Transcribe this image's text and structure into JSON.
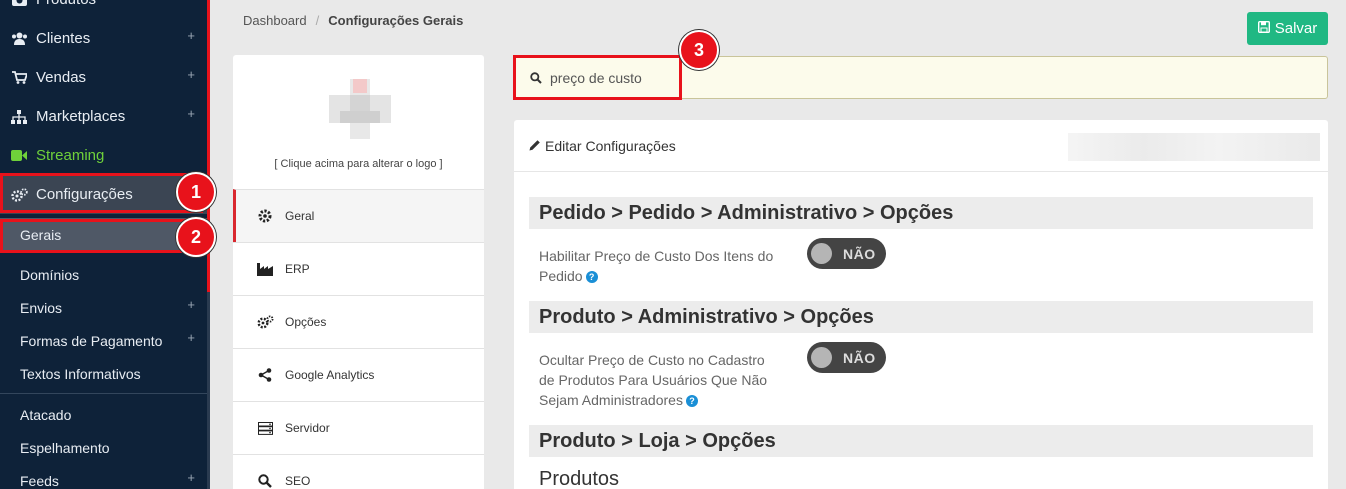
{
  "sidebar": {
    "items": [
      {
        "label": "Produtos",
        "icon": "camera-icon",
        "has_plus": true
      },
      {
        "label": "Clientes",
        "icon": "users-icon",
        "has_plus": true
      },
      {
        "label": "Vendas",
        "icon": "cart-icon",
        "has_plus": true
      },
      {
        "label": "Marketplaces",
        "icon": "sitemap-icon",
        "has_plus": true
      },
      {
        "label": "Streaming",
        "icon": "video-icon",
        "has_plus": false,
        "color": "#6fd13a"
      },
      {
        "label": "Configurações",
        "icon": "gears-icon",
        "has_plus": false
      }
    ],
    "sub_items": [
      {
        "label": "Gerais"
      },
      {
        "label": "Domínios"
      },
      {
        "label": "Envios",
        "has_plus": true
      },
      {
        "label": "Formas de Pagamento",
        "has_plus": true
      },
      {
        "label": "Textos Informativos"
      },
      {
        "label": "Atacado"
      },
      {
        "label": "Espelhamento"
      },
      {
        "label": "Feeds",
        "has_plus": true
      }
    ],
    "plus_symbol": "+"
  },
  "badges": [
    "1",
    "2",
    "3"
  ],
  "breadcrumb": {
    "items": [
      "Dashboard",
      "Configurações Gerais"
    ],
    "separator": "/"
  },
  "save_button": {
    "label": "Salvar"
  },
  "settings_menu": {
    "logo_caption": "[ Clique acima para alterar o logo ]",
    "items": [
      {
        "label": "Geral",
        "icon": "gear-icon"
      },
      {
        "label": "ERP",
        "icon": "factory-icon"
      },
      {
        "label": "Opções",
        "icon": "gears-icon"
      },
      {
        "label": "Google Analytics",
        "icon": "share-icon"
      },
      {
        "label": "Servidor",
        "icon": "server-icon"
      },
      {
        "label": "SEO",
        "icon": "search-icon"
      }
    ]
  },
  "search": {
    "value": "preço de custo"
  },
  "edit_panel": {
    "title": "Editar Configurações",
    "sections": [
      {
        "title": "Pedido > Pedido > Administrativo > Opções",
        "option_label": "Habilitar Preço de Custo Dos Itens do Pedido",
        "toggle": "NÃO"
      },
      {
        "title": "Produto > Administrativo > Opções",
        "option_label": "Ocultar Preço de Custo no Cadastro de Produtos Para Usuários Que Não Sejam Administradores",
        "toggle": "NÃO"
      },
      {
        "title": "Produto > Loja > Opções"
      }
    ],
    "subheading": "Produtos"
  },
  "colors": {
    "sidebar_bg": "#0e2239",
    "highlight_red": "#e8121b",
    "save_green": "#20b883",
    "streaming_green": "#6fd13a"
  }
}
